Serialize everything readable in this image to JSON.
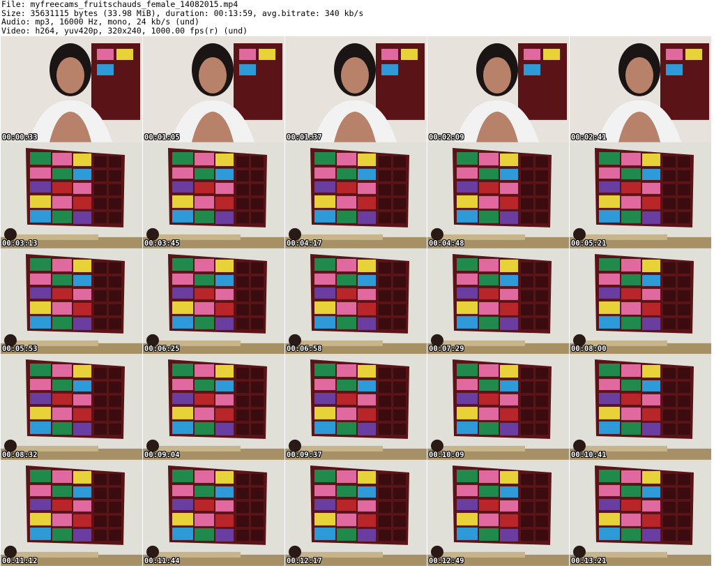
{
  "header": {
    "file_line": "File: myfreecams_fruitschauds_female_14082015.mp4",
    "size_line": "Size: 35631115 bytes (33.98 MiB), duration: 00:13:59, avg.bitrate: 340 kb/s",
    "audio_line": "Audio: mp3, 16000 Hz, mono, 24 kb/s (und)",
    "video_line": "Video: h264, yuv420p, 320x240, 1000.00 fps(r) (und)"
  },
  "thumbnails": [
    {
      "timestamp": "00:00:33",
      "scene": "person"
    },
    {
      "timestamp": "00:01:05",
      "scene": "person"
    },
    {
      "timestamp": "00:01:37",
      "scene": "person"
    },
    {
      "timestamp": "00:02:09",
      "scene": "person"
    },
    {
      "timestamp": "00:02:41",
      "scene": "person"
    },
    {
      "timestamp": "00:03:13",
      "scene": "shelf"
    },
    {
      "timestamp": "00:03:45",
      "scene": "shelf"
    },
    {
      "timestamp": "00:04:17",
      "scene": "shelf"
    },
    {
      "timestamp": "00:04:48",
      "scene": "shelf"
    },
    {
      "timestamp": "00:05:21",
      "scene": "shelf"
    },
    {
      "timestamp": "00:05:53",
      "scene": "shelf"
    },
    {
      "timestamp": "00:06:25",
      "scene": "shelf"
    },
    {
      "timestamp": "00:06:58",
      "scene": "shelf"
    },
    {
      "timestamp": "00:07:29",
      "scene": "shelf"
    },
    {
      "timestamp": "00:08:00",
      "scene": "shelf"
    },
    {
      "timestamp": "00:08:32",
      "scene": "shelf"
    },
    {
      "timestamp": "00:09:04",
      "scene": "shelf"
    },
    {
      "timestamp": "00:09:37",
      "scene": "shelf"
    },
    {
      "timestamp": "00:10:09",
      "scene": "shelf"
    },
    {
      "timestamp": "00:10:41",
      "scene": "shelf"
    },
    {
      "timestamp": "00:11:12",
      "scene": "shelf"
    },
    {
      "timestamp": "00:11:44",
      "scene": "shelf"
    },
    {
      "timestamp": "00:12:17",
      "scene": "shelf"
    },
    {
      "timestamp": "00:12:49",
      "scene": "shelf"
    },
    {
      "timestamp": "00:13:21",
      "scene": "shelf"
    }
  ],
  "colors": {
    "background": "#ffffff",
    "wall": "#dcdcd4",
    "shelf_frame": "#5a1418",
    "panel_green": "#1f8a4c",
    "panel_pink": "#e06aa0",
    "panel_yellow": "#e8d23a",
    "panel_blue": "#2f9ad8",
    "panel_purple": "#6a3ea0",
    "panel_red": "#b8262a",
    "timestamp_text": "#ffffff"
  }
}
